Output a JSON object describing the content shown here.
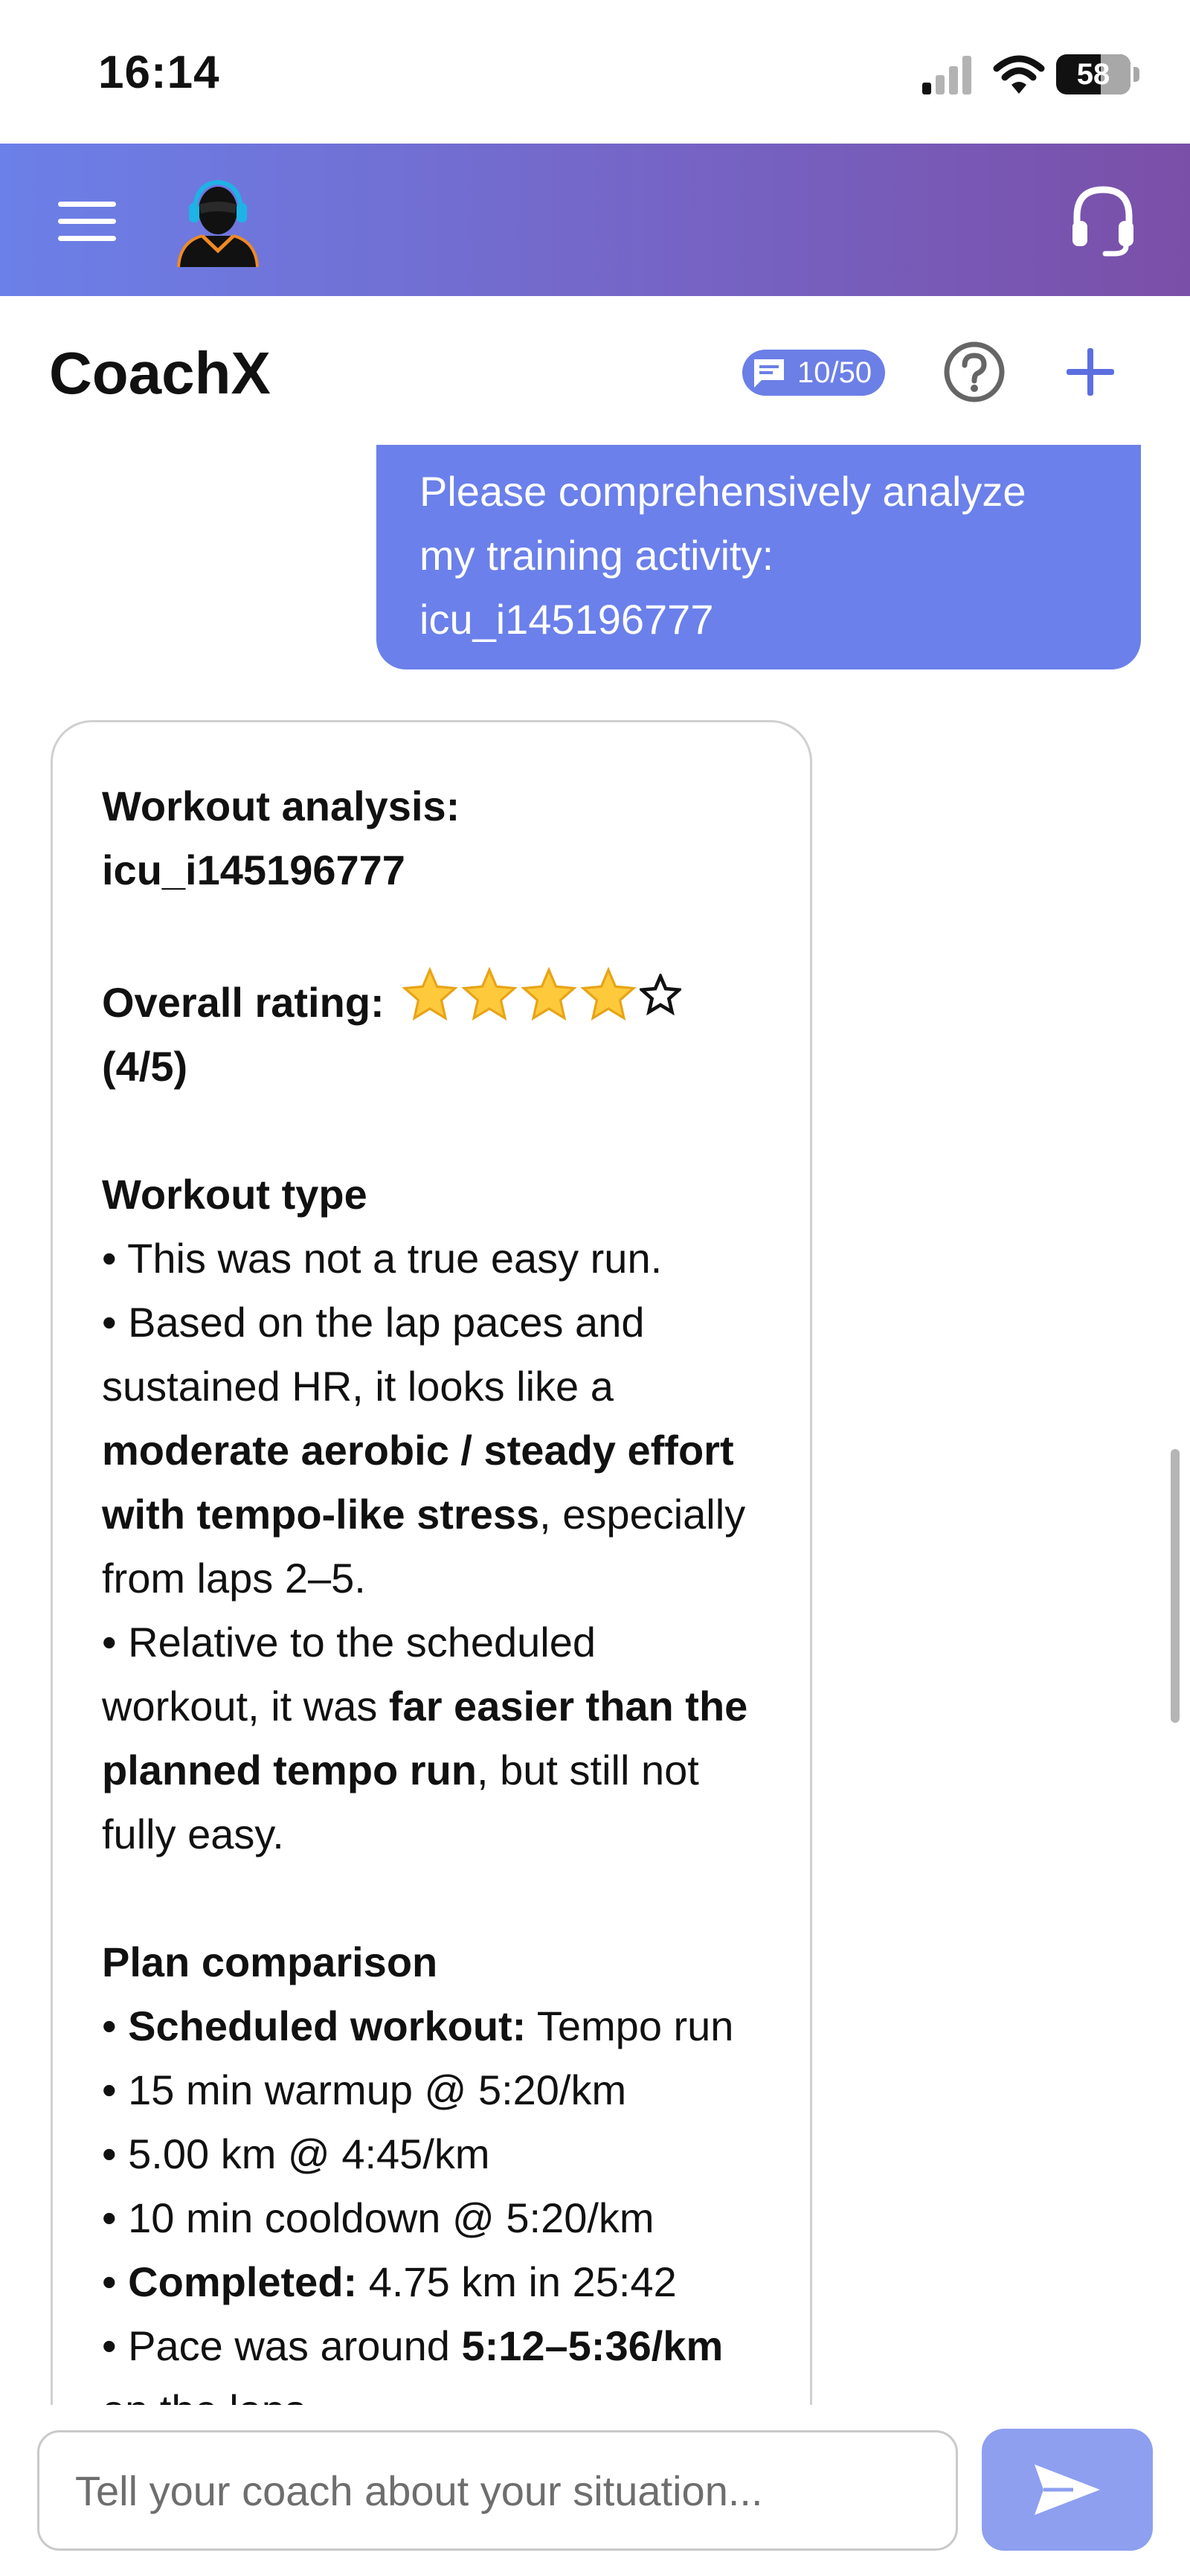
{
  "status_bar": {
    "time": "16:14",
    "battery_level": "58",
    "icons": [
      "signal-icon",
      "wifi-icon",
      "battery-icon"
    ]
  },
  "header": {
    "icons": [
      "menu-icon",
      "coach-avatar",
      "headset-icon"
    ],
    "accent_gradient": [
      "#6b80e8",
      "#7a4fa8"
    ]
  },
  "title_row": {
    "title": "CoachX",
    "message_count": "10/50",
    "icons": [
      "chat-icon",
      "help-icon",
      "plus-icon"
    ],
    "accent_color": "#6b7fe6"
  },
  "chat": {
    "user_message": {
      "lines": [
        "Please comprehensively analyze",
        "my training activity:",
        "icu_i145196777"
      ]
    },
    "coach_message": {
      "heading_line1": "Workout analysis:",
      "heading_line2": "icu_i145196777",
      "rating_label": "Overall rating:",
      "rating_stars": 4,
      "rating_max": 5,
      "rating_text": "(4/5)",
      "workout_type": {
        "heading": "Workout type",
        "bullet1": "• This was not a true easy run.",
        "bullet2_line1": "• Based on the lap paces and",
        "bullet2_line2": "sustained HR, it looks like a",
        "bullet2_bold_line1": "moderate aerobic / steady effort",
        "bullet2_bold_line2": "with tempo-like stress",
        "bullet2_tail_line2": ", especially",
        "bullet2_line4": "from laps 2–5.",
        "bullet3_line1": "• Relative to the scheduled",
        "bullet3_line2_pre": "workout, it was ",
        "bullet3_bold_line2": "far easier than the",
        "bullet3_bold_line3": "planned tempo run",
        "bullet3_tail_line3": ", but still not",
        "bullet3_line4": "fully easy."
      },
      "plan_comparison": {
        "heading": "Plan comparison",
        "scheduled_label": "Scheduled workout:",
        "scheduled_value": " Tempo run",
        "item1": "• 15 min warmup @ 5:20/km",
        "item2": "• 5.00 km @ 4:45/km",
        "item3": "• 10 min cooldown @ 5:20/km",
        "completed_label": "Completed:",
        "completed_value": " 4.75 km in 25:42",
        "pace_pre": "• Pace was around ",
        "pace_bold": "5:12–5:36/km",
        "pace_line2": "on the laps."
      }
    }
  },
  "composer": {
    "placeholder": "Tell your coach about your situation...",
    "send_icon": "send-icon"
  }
}
